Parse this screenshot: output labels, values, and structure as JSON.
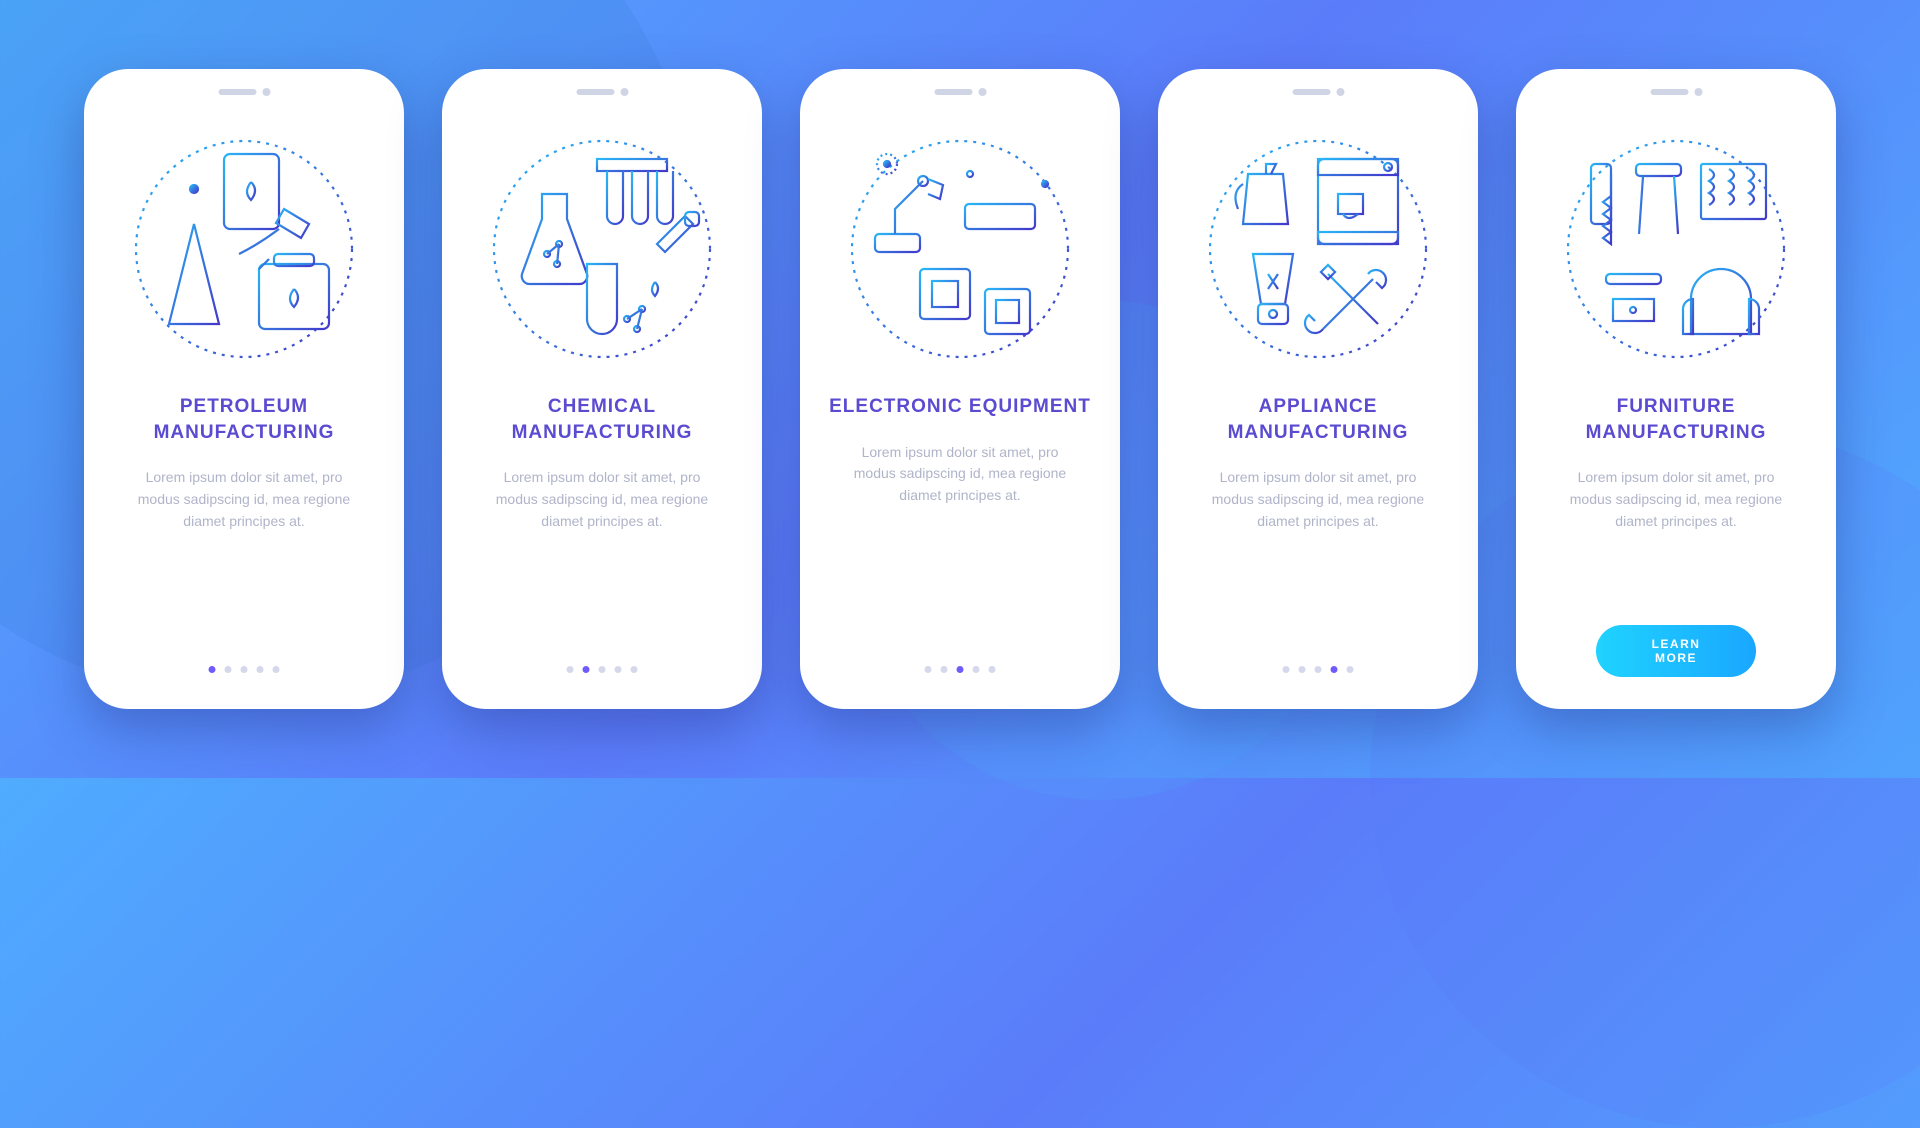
{
  "screens": [
    {
      "title": "PETROLEUM MANUFACTURING",
      "desc": "Lorem ipsum dolor sit amet, pro modus sadipscing id, mea regione diamet principes at.",
      "active_dot": 0,
      "icon": "petroleum"
    },
    {
      "title": "CHEMICAL MANUFACTURING",
      "desc": "Lorem ipsum dolor sit amet, pro modus sadipscing id, mea regione diamet principes at.",
      "active_dot": 1,
      "icon": "chemical"
    },
    {
      "title": "ELECTRONIC EQUIPMENT",
      "desc": "Lorem ipsum dolor sit amet, pro modus sadipscing id, mea regione diamet principes at.",
      "active_dot": 2,
      "icon": "electronic"
    },
    {
      "title": "APPLIANCE MANUFACTURING",
      "desc": "Lorem ipsum dolor sit amet, pro modus sadipscing id, mea regione diamet principes at.",
      "active_dot": 3,
      "icon": "appliance"
    },
    {
      "title": "FURNITURE MANUFACTURING",
      "desc": "Lorem ipsum dolor sit amet, pro modus sadipscing id, mea regione diamet principes at.",
      "active_dot": 4,
      "icon": "furniture",
      "cta": "LEARN MORE"
    }
  ],
  "dot_count": 5,
  "colors": {
    "grad_start": "#29b6f6",
    "grad_end": "#4338ca"
  }
}
